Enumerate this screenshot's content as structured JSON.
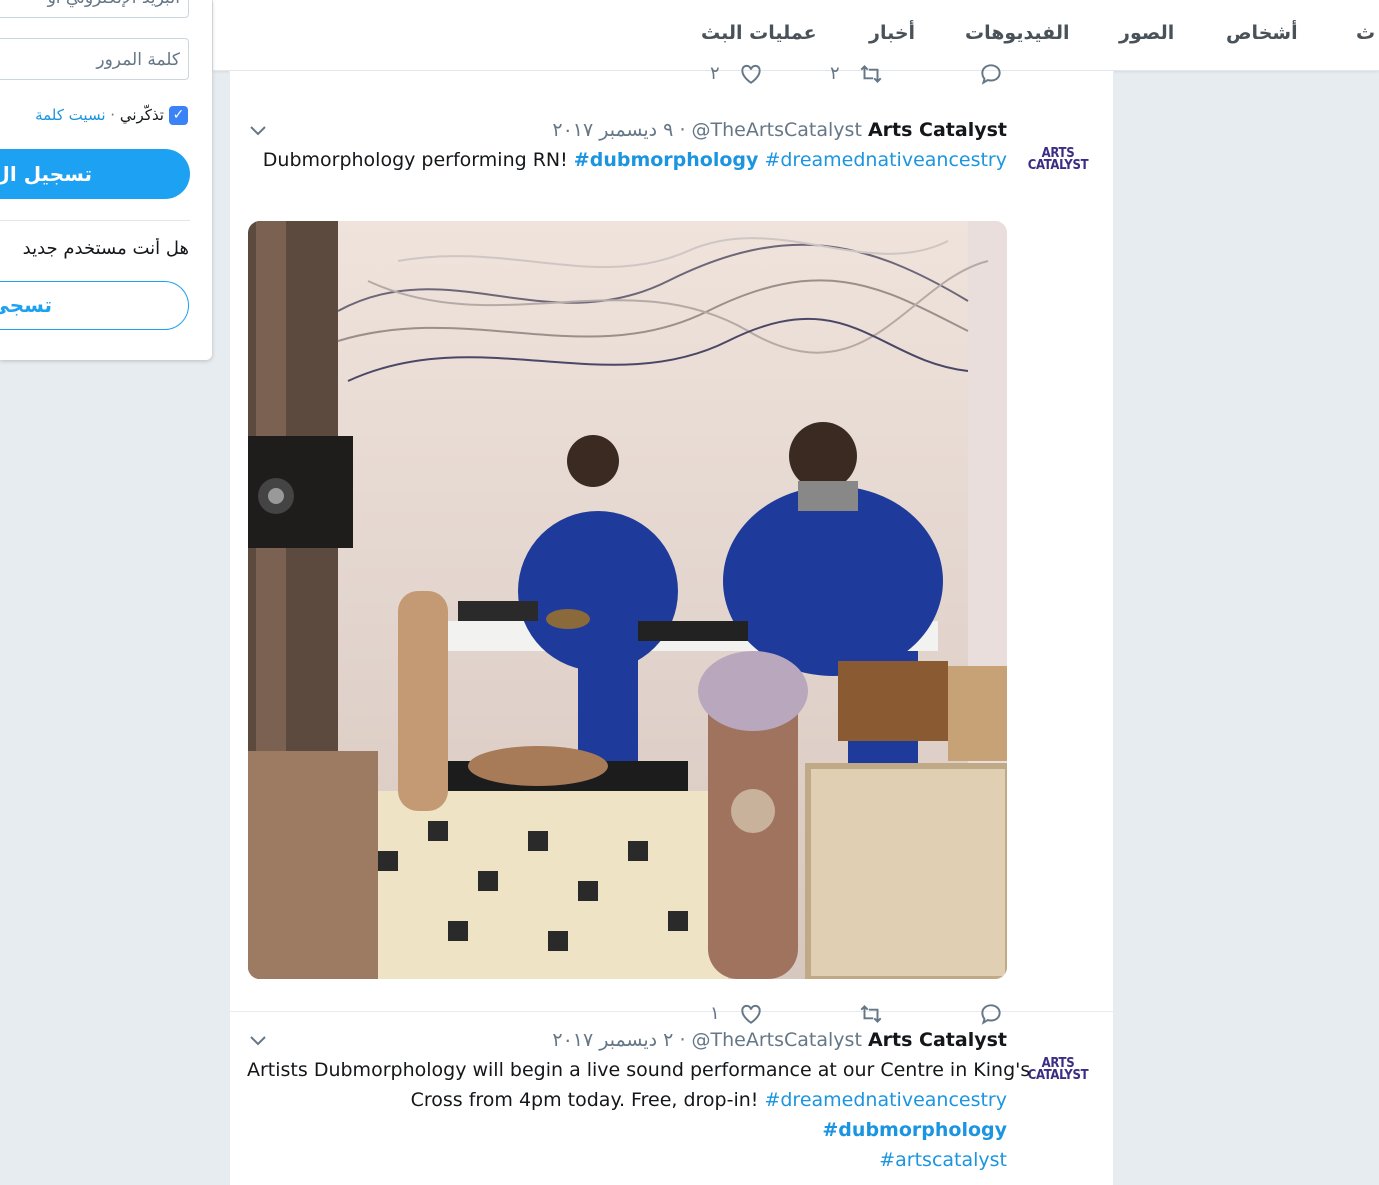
{
  "nav": {
    "items": [
      "عمليات البث",
      "أخبار",
      "الفيديوهات",
      "الصور",
      "أشخاص",
      "ث"
    ]
  },
  "login": {
    "email_placeholder": "البريد الإلكتروني أو",
    "password_placeholder": "كلمة المرور",
    "remember_label": "تذكّرني",
    "separator": "·",
    "forgot_label": "نسيت كلمة",
    "login_button": "تسجيل ال",
    "new_user_text": "هل أنت مستخدم جديد",
    "signup_button": "تسجي"
  },
  "previous_tweet": {
    "like_count": "٢",
    "retweet_count": "٢"
  },
  "tweets": [
    {
      "avatar_text_1": "ARTS",
      "avatar_text_2": "CATALYST",
      "name": "Arts Catalyst",
      "handle": "@TheArtsCatalyst",
      "separator": "·",
      "date": "٩ ديسمبر ٢٠١٧",
      "text": "Dubmorphology performing RN!",
      "hashtag_1": "#dubmorphology",
      "hashtag_2": "#dreamednativeancestry",
      "like_count": "١"
    },
    {
      "avatar_text_1": "ARTS",
      "avatar_text_2": "CATALYST",
      "name": "Arts Catalyst",
      "handle": "@TheArtsCatalyst",
      "separator": "·",
      "date": "٢ ديسمبر ٢٠١٧",
      "text_line_1": "Artists Dubmorphology will begin a live sound performance at our Centre in King's",
      "text_line_2": "Cross from 4pm today. Free, drop-in!",
      "hashtag_1": "#dreamednativeancestry",
      "hashtag_2": "#dubmorphology",
      "hashtag_3": "#artscatalyst"
    }
  ],
  "colors": {
    "accent": "#1da1f2",
    "link": "#1b95e0",
    "background": "#e6ecf0"
  }
}
